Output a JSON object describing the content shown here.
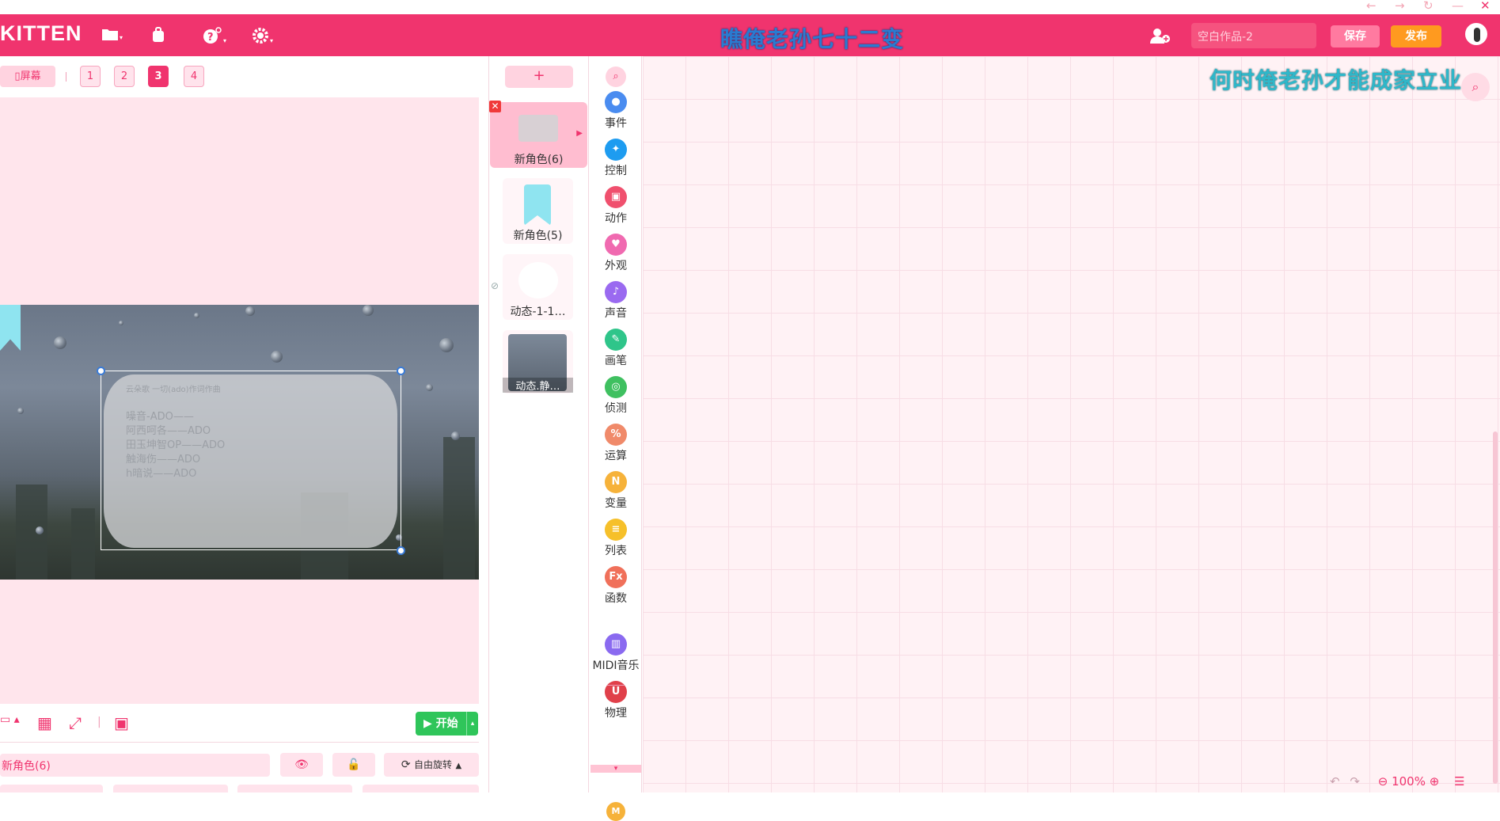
{
  "window_controls": {
    "back": "←",
    "forward": "→",
    "refresh": "↻",
    "minimize": "—",
    "close": "✕"
  },
  "header": {
    "logo": "KITTEN",
    "title": "瞧俺老孙七十二变",
    "project_name_placeholder": "空白作品-2",
    "save_label": "保存",
    "publish_label": "发布"
  },
  "stage": {
    "screen_button": "屏幕",
    "pages": [
      "1",
      "2",
      "3",
      "4"
    ],
    "active_page": "3",
    "start_label": "开始",
    "paper_lines": [
      "云朵歌 一切(ado)作词作曲",
      "噪音-ADO——",
      "阿西呵各——ADO",
      "田玉坤智OP——ADO",
      "触海伤——ADO",
      "h暗说——ADO"
    ]
  },
  "sprite_props": {
    "name": "新角色(6)",
    "rotation_label": "自由旋转"
  },
  "sprites": {
    "add_label": "+",
    "items": [
      {
        "label": "新角色(6)"
      },
      {
        "label": "新角色(5)"
      },
      {
        "label": "动态-1-1…"
      },
      {
        "label": "动态.静…"
      }
    ]
  },
  "categories": [
    {
      "label": "事件",
      "color": "#4a8cf0",
      "icon": "●"
    },
    {
      "label": "控制",
      "color": "#1e9cf0",
      "icon": "✦"
    },
    {
      "label": "动作",
      "color": "#f0506e",
      "icon": "▣"
    },
    {
      "label": "外观",
      "color": "#f06ab0",
      "icon": "♥"
    },
    {
      "label": "声音",
      "color": "#9a6af0",
      "icon": "♪"
    },
    {
      "label": "画笔",
      "color": "#2fc58a",
      "icon": "✎"
    },
    {
      "label": "侦测",
      "color": "#3fc060",
      "icon": "◎"
    },
    {
      "label": "运算",
      "color": "#f08a6a",
      "icon": "%"
    },
    {
      "label": "变量",
      "color": "#f6b23a",
      "icon": "N"
    },
    {
      "label": "列表",
      "color": "#f6c02a",
      "icon": "≡"
    },
    {
      "label": "函数",
      "color": "#f0705a",
      "icon": "Fx"
    },
    {
      "label": "MIDI音乐",
      "color": "#8a6af0",
      "icon": "▥"
    },
    {
      "label": "物理",
      "color": "#e0404a",
      "icon": "U"
    }
  ],
  "workspace": {
    "overlay_text": "何时俺老孙才能成家立业",
    "zoom": "100%"
  },
  "colors": {
    "brand": "#f0346e",
    "start_green": "#2fc55a",
    "publish_orange": "#ff9a1f"
  }
}
